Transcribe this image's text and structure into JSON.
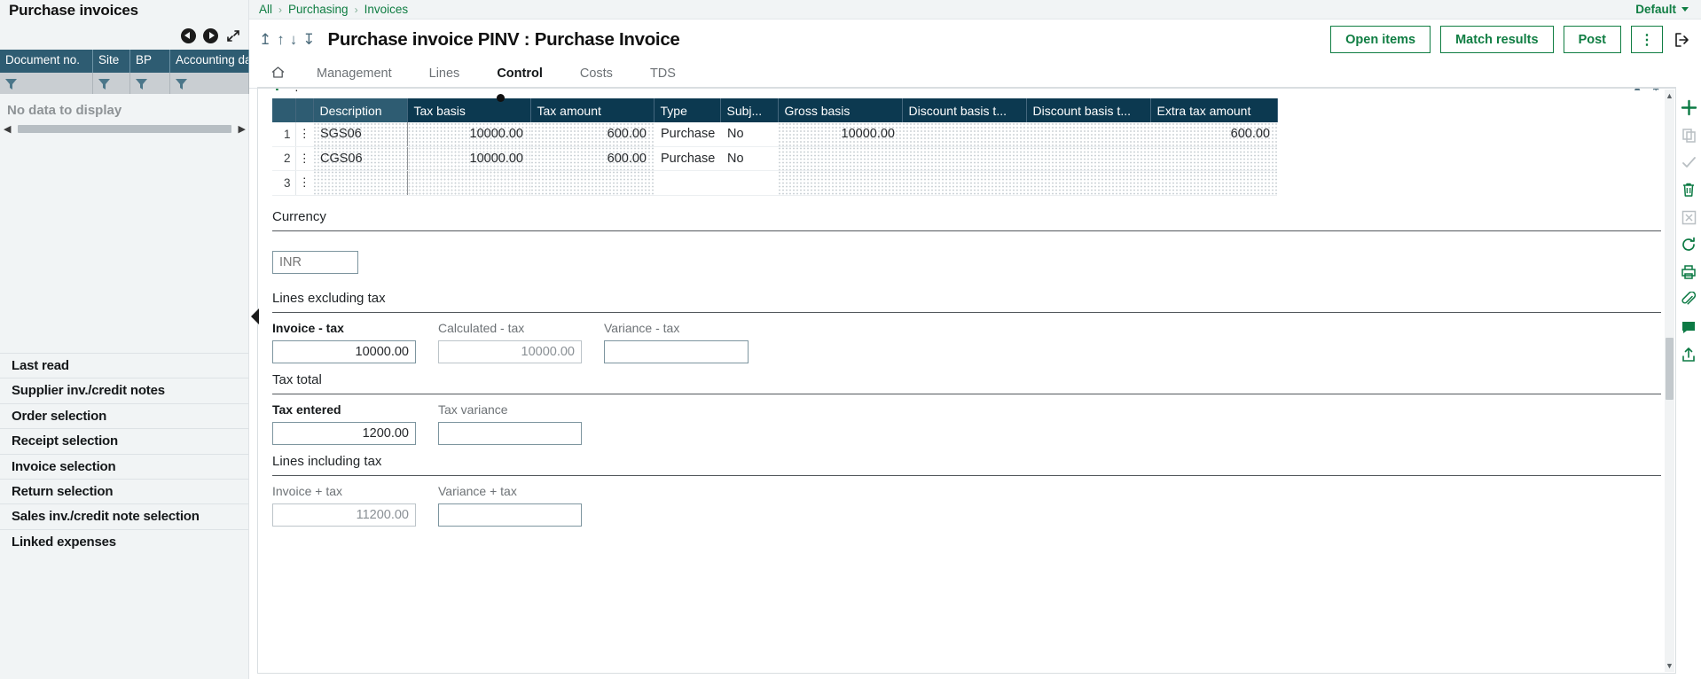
{
  "left_panel": {
    "title": "Purchase invoices",
    "nav": {
      "prev_icon": "circle-left-arrow-icon",
      "next_icon": "circle-right-arrow-icon",
      "expand_icon": "expand-diagonal-icon"
    },
    "columns": [
      "Document no.",
      "Site",
      "BP",
      "Accounting da"
    ],
    "filter_icon": "funnel-icon",
    "empty_message": "No data to display",
    "items": [
      "Last read",
      "Supplier inv./credit notes",
      "Order selection",
      "Receipt selection",
      "Invoice selection",
      "Return selection",
      "Sales inv./credit note selection",
      "Linked expenses"
    ]
  },
  "header": {
    "breadcrumb": [
      "All",
      "Purchasing",
      "Invoices"
    ],
    "breadcrumb_separator": "›",
    "profile": {
      "label": "Default",
      "caret_icon": "chevron-down-icon"
    },
    "title": "Purchase invoice PINV : Purchase Invoice",
    "nav_icons": [
      "first-record-icon",
      "previous-record-icon",
      "next-record-icon",
      "last-record-icon"
    ],
    "actions": [
      {
        "label": "Open items",
        "name": "open-items-button"
      },
      {
        "label": "Match results",
        "name": "match-results-button"
      },
      {
        "label": "Post",
        "name": "post-button"
      }
    ],
    "kebab_label": "⋮",
    "exit_icon": "exit-icon"
  },
  "tabs": [
    {
      "label": "",
      "icon": "home-icon",
      "active": false
    },
    {
      "label": "Management",
      "active": false
    },
    {
      "label": "Lines",
      "active": false
    },
    {
      "label": "Control",
      "active": true
    },
    {
      "label": "Costs",
      "active": false
    },
    {
      "label": "TDS",
      "active": false
    }
  ],
  "grid": {
    "columns": [
      "",
      "",
      "Description",
      "Tax basis",
      "Tax amount",
      "Type",
      "Subj...",
      "Gross basis",
      "Discount basis t...",
      "Discount basis t...",
      "Extra tax amount"
    ],
    "rows": [
      {
        "no": "1",
        "description": "SGS06",
        "tax_basis": "10000.00",
        "tax_amount": "600.00",
        "type": "Purchase",
        "subject": "No",
        "gross_basis": "10000.00",
        "discount_basis_1": "",
        "discount_basis_2": "",
        "extra_tax_amount": "600.00"
      },
      {
        "no": "2",
        "description": "CGS06",
        "tax_basis": "10000.00",
        "tax_amount": "600.00",
        "type": "Purchase",
        "subject": "No",
        "gross_basis": "",
        "discount_basis_1": "",
        "discount_basis_2": "",
        "extra_tax_amount": ""
      },
      {
        "no": "3",
        "description": "",
        "tax_basis": "",
        "tax_amount": "",
        "type": "",
        "subject": "",
        "gross_basis": "",
        "discount_basis_1": "",
        "discount_basis_2": "",
        "extra_tax_amount": ""
      }
    ],
    "row_menu_icon": "kebab-vertical-icon"
  },
  "sections": {
    "currency": {
      "title": "Currency",
      "field": {
        "label": "",
        "placeholder": "INR",
        "value": ""
      }
    },
    "lines_excluding_tax": {
      "title": "Lines excluding tax",
      "fields": [
        {
          "label": "Invoice - tax",
          "value": "10000.00",
          "required": true,
          "readonly": false
        },
        {
          "label": "Calculated - tax",
          "value": "10000.00",
          "required": false,
          "readonly": true
        },
        {
          "label": "Variance - tax",
          "value": "",
          "required": false,
          "readonly": false
        }
      ]
    },
    "tax_total": {
      "title": "Tax total",
      "fields": [
        {
          "label": "Tax entered",
          "value": "1200.00",
          "required": true,
          "readonly": false
        },
        {
          "label": "Tax variance",
          "value": "",
          "required": false,
          "readonly": false
        }
      ]
    },
    "lines_including_tax": {
      "title": "Lines including tax",
      "fields": [
        {
          "label": "Invoice + tax",
          "value": "11200.00",
          "required": false,
          "readonly": true
        },
        {
          "label": "Variance + tax",
          "value": "",
          "required": false,
          "readonly": false
        }
      ]
    }
  },
  "right_rail": {
    "icons": [
      "add-icon",
      "copy-icon",
      "check-icon",
      "delete-icon",
      "cancel-icon",
      "refresh-icon",
      "print-icon",
      "attach-icon",
      "comment-icon",
      "share-icon"
    ]
  },
  "colors": {
    "accent_green": "#0f7d42",
    "header_teal": "#2e5c72",
    "header_navy": "#0c3950",
    "panel_bg": "#f1f4f5"
  }
}
